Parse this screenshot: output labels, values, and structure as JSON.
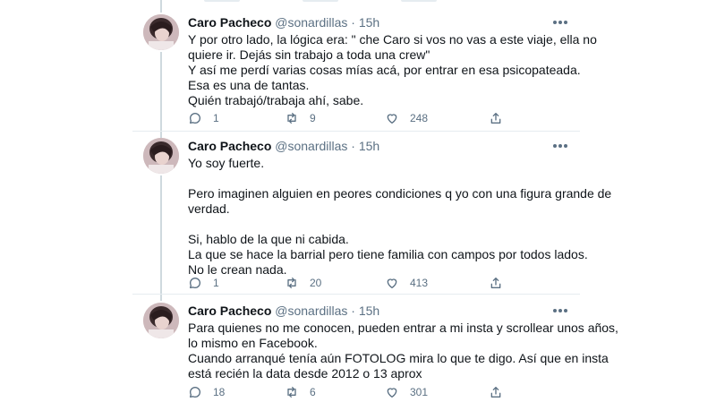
{
  "colors": {
    "text": "#0f1419",
    "secondary": "#5b7083",
    "divider": "#e6ecf0",
    "thread": "#cfd9de"
  },
  "tweets": [
    {
      "name": "Caro Pacheco",
      "handle": "@sonardillas",
      "separator": "·",
      "time": "15h",
      "lines": [
        "Y por otro lado, la lógica era: \" che Caro si vos no vas a este viaje, ella no",
        "quiere ir. Dejás sin trabajo a toda una crew\"",
        "Y así me perdí varias cosas mías acá, por entrar en esa psicopateada.",
        "Esa es una de tantas.",
        "Quién trabajó/trabaja ahí, sabe."
      ],
      "replies": "1",
      "retweets": "9",
      "likes": "248"
    },
    {
      "name": "Caro Pacheco",
      "handle": "@sonardillas",
      "separator": "·",
      "time": "15h",
      "lines": [
        "Yo soy fuerte.",
        "",
        "Pero imaginen alguien en peores condiciones q yo con una figura grande de",
        "verdad.",
        "",
        "Si, hablo de la que ni cabida.",
        "La que se hace la barrial pero tiene familia con campos por todos lados.",
        "No le crean nada."
      ],
      "replies": "1",
      "retweets": "20",
      "likes": "413"
    },
    {
      "name": "Caro Pacheco",
      "handle": "@sonardillas",
      "separator": "·",
      "time": "15h",
      "lines": [
        "Para quienes no me conocen, pueden entrar a mi insta y scrollear unos años,",
        "lo mismo en Facebook.",
        "Cuando arranqué tenía aún FOTOLOG mira lo que te digo. Así que en insta",
        "está recién la data desde 2012 o 13 aprox"
      ],
      "replies": "18",
      "retweets": "6",
      "likes": "301"
    }
  ]
}
